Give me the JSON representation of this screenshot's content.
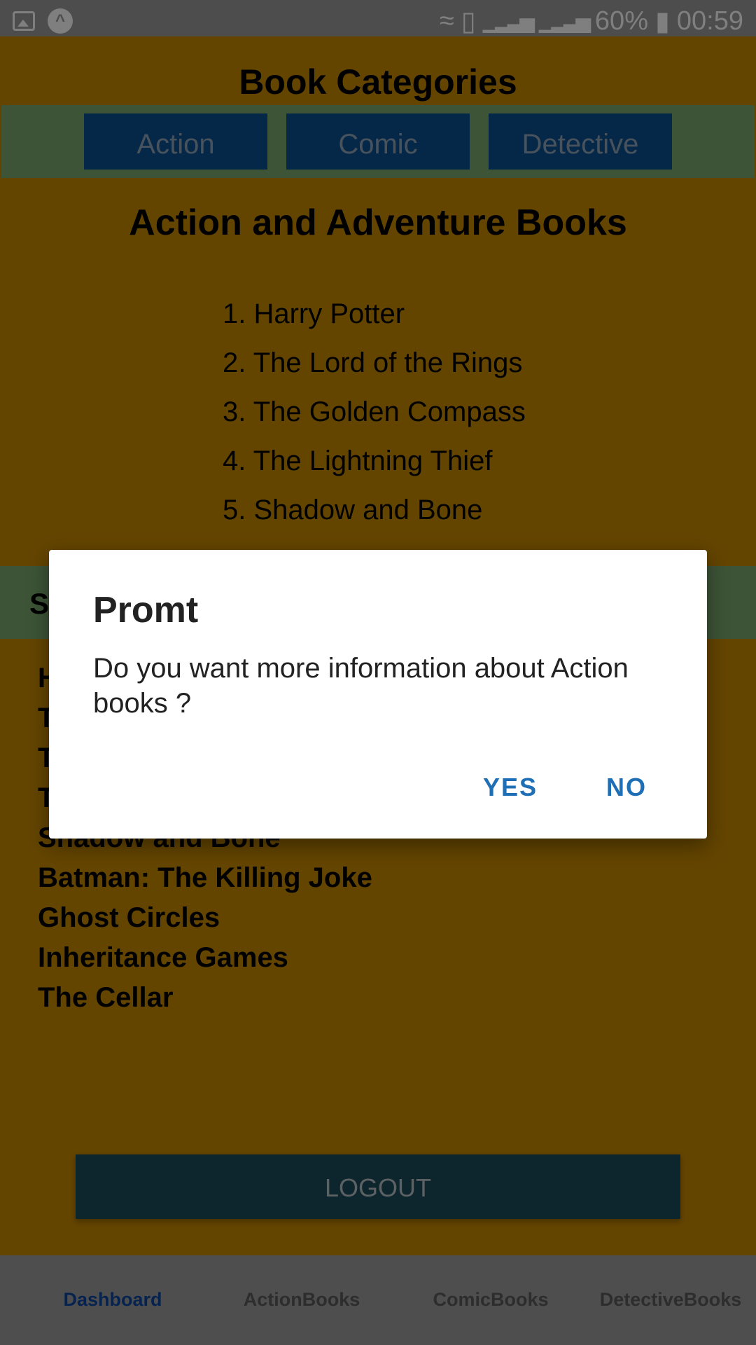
{
  "status_bar": {
    "battery": "60%",
    "time": "00:59",
    "left_icons": [
      "image-icon",
      "app-notification-icon"
    ],
    "right_icons": [
      "wifi-icon",
      "sim-icon",
      "signal-icon",
      "signal-icon",
      "battery-icon"
    ]
  },
  "header": {
    "title": "Book Categories"
  },
  "categories": [
    "Action",
    "Comic",
    "Detective"
  ],
  "section": {
    "title": "Action and Adventure Books",
    "items": [
      "1. Harry Potter",
      "2. The Lord of the Rings",
      "3. The Golden Compass",
      "4. The Lightning Thief",
      "5. Shadow and Bone"
    ]
  },
  "selected": {
    "band_label_visible": "S",
    "visible_items": [
      "H",
      "T",
      "T",
      "T",
      "Shadow and Bone",
      "Batman: The Killing Joke",
      "Ghost Circles",
      "Inheritance Games",
      "The Cellar"
    ]
  },
  "logout_label": "LOGOUT",
  "bottom_nav": [
    {
      "label": "Dashboard",
      "active": true
    },
    {
      "label": "ActionBooks",
      "active": false
    },
    {
      "label": "ComicBooks",
      "active": false
    },
    {
      "label": "DetectiveBooks",
      "active": false
    }
  ],
  "dialog": {
    "title": "Promt",
    "message": "Do you want more information about Action books ?",
    "yes_label": "YES",
    "no_label": "NO"
  },
  "colors": {
    "background": "#c98a00",
    "category_bar": "#7aa86f",
    "category_button": "#0b4e91",
    "logout_button": "#1a4a5a",
    "accent": "#1e6fb5",
    "active_nav": "#0d47a1"
  }
}
